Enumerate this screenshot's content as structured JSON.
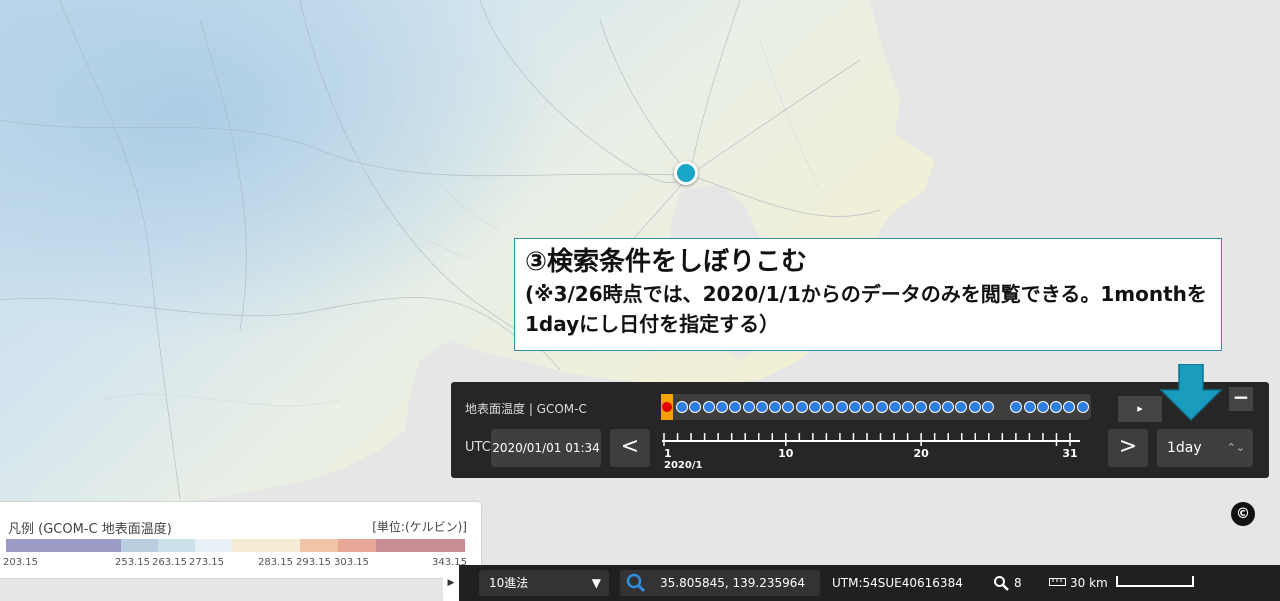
{
  "callout": {
    "title": "③検索条件をしぼりこむ",
    "description": "(※3/26時点では、2020/1/1からのデータのみを閲覧できる。1monthを1dayにし日付を指定する）"
  },
  "time_panel": {
    "layer_label": "地表面温度 | GCOM-C",
    "utc_label": "UTC",
    "datetime": "2020/01/01 01:34",
    "prev_label": "<",
    "next_label": ">",
    "play_label": "▸",
    "minimize_label": "−",
    "interval": "1day",
    "timeline_labels": [
      "1",
      "10",
      "20",
      "31"
    ],
    "timeline_month": "2020/1",
    "available_days": 30,
    "selected_day": 1
  },
  "legend": {
    "title": "凡例 (GCOM-C 地表面温度)",
    "unit": "[単位:(ケルビン)]",
    "ticks": [
      "203.15",
      "253.15",
      "263.15",
      "273.15",
      "283.15",
      "293.15",
      "303.15",
      "343.15"
    ],
    "colors": [
      "#9b9bc4",
      "#b9cfe0",
      "#cce0ea",
      "#e6f0f5",
      "#f7ecd4",
      "#f2c4a6",
      "#e8a898",
      "#c98c92"
    ]
  },
  "statusbar": {
    "coord_format": "10進法",
    "coordinates": "35.805845, 139.235964",
    "utm": "UTM:54SUE40616384",
    "zoom": "8",
    "scale": "30 km"
  },
  "compass_icon": "copyright-like-compass-icon",
  "colors": {
    "accent": "#1aa6c6",
    "panel": "#262626",
    "dot": "#2e7de0",
    "selected": "#f5a100"
  }
}
